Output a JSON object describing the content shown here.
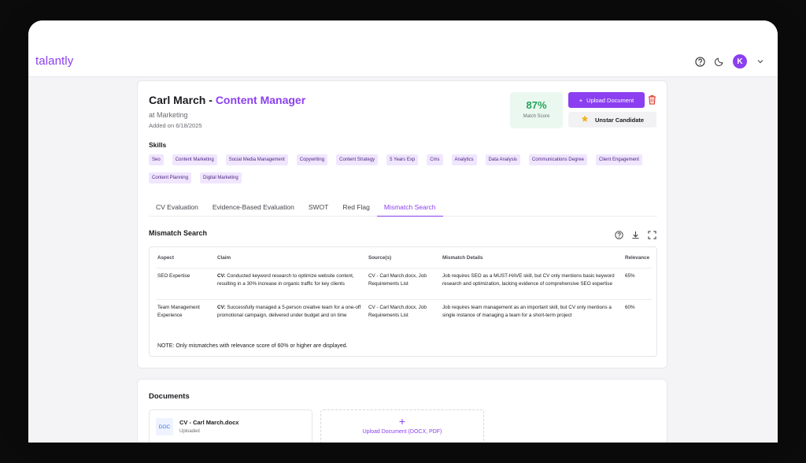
{
  "app": {
    "brand": "talantly",
    "avatar_initial": "K"
  },
  "candidate": {
    "name": "Carl March",
    "separator": " - ",
    "role": "Content Manager",
    "department": "at Marketing",
    "added": "Added on 6/18/2025"
  },
  "match": {
    "score": "87%",
    "label": "Match Score"
  },
  "actions": {
    "upload_plus": "+",
    "upload_label": "Upload Document",
    "unstar_label": "Unstar Candidate"
  },
  "skills": {
    "title": "Skills",
    "items": [
      "Seo",
      "Content Marketing",
      "Social Media Management",
      "Copywriting",
      "Content Strategy",
      "5 Years Exp",
      "Cms",
      "Analytics",
      "Data Analysis",
      "Communications Degree",
      "Client Engagement",
      "Content Planning",
      "Digital Marketing"
    ]
  },
  "tabs": [
    "CV Evaluation",
    "Evidence-Based Evaluation",
    "SWOT",
    "Red Flag",
    "Mismatch Search"
  ],
  "active_tab": "Mismatch Search",
  "mismatch": {
    "title": "Mismatch Search",
    "headers": [
      "Aspect",
      "Claim",
      "Source(s)",
      "Mismatch Details",
      "Relevance"
    ],
    "rows": [
      {
        "aspect": "SEO Expertise",
        "claim_prefix": "CV:",
        "claim": " Conducted keyword research to optimize website content, resulting in a 30% increase in organic traffic for key clients",
        "sources": "CV - Carl March.docx, Job Requirements List",
        "details": "Job requires SEO as a MUST-HAVE skill, but CV only mentions basic keyword research and optimization, lacking evidence of comprehensive SEO expertise",
        "relevance": "65%"
      },
      {
        "aspect": "Team Management Experience",
        "claim_prefix": "CV:",
        "claim": " Successfully managed a 5-person creative team for a one-off promotional campaign, delivered under budget and on time",
        "sources": "CV - Carl March.docx, Job Requirements List",
        "details": "Job requires team management as an important skill, but CV only mentions a single instance of managing a team for a short-term project",
        "relevance": "60%"
      }
    ],
    "note": "NOTE: Only mismatches with relevance score of 60% or higher are displayed."
  },
  "documents": {
    "title": "Documents",
    "file": {
      "badge": "DOC",
      "name": "CV - Carl March.docx",
      "status": "Uploaded"
    },
    "upload_plus": "+",
    "upload_label": "Upload Document (DOCX, PDF)"
  },
  "colors": {
    "accent": "#8b3ff0",
    "score": "#23a35c",
    "danger": "#e0433a",
    "star": "#f2b21c"
  }
}
